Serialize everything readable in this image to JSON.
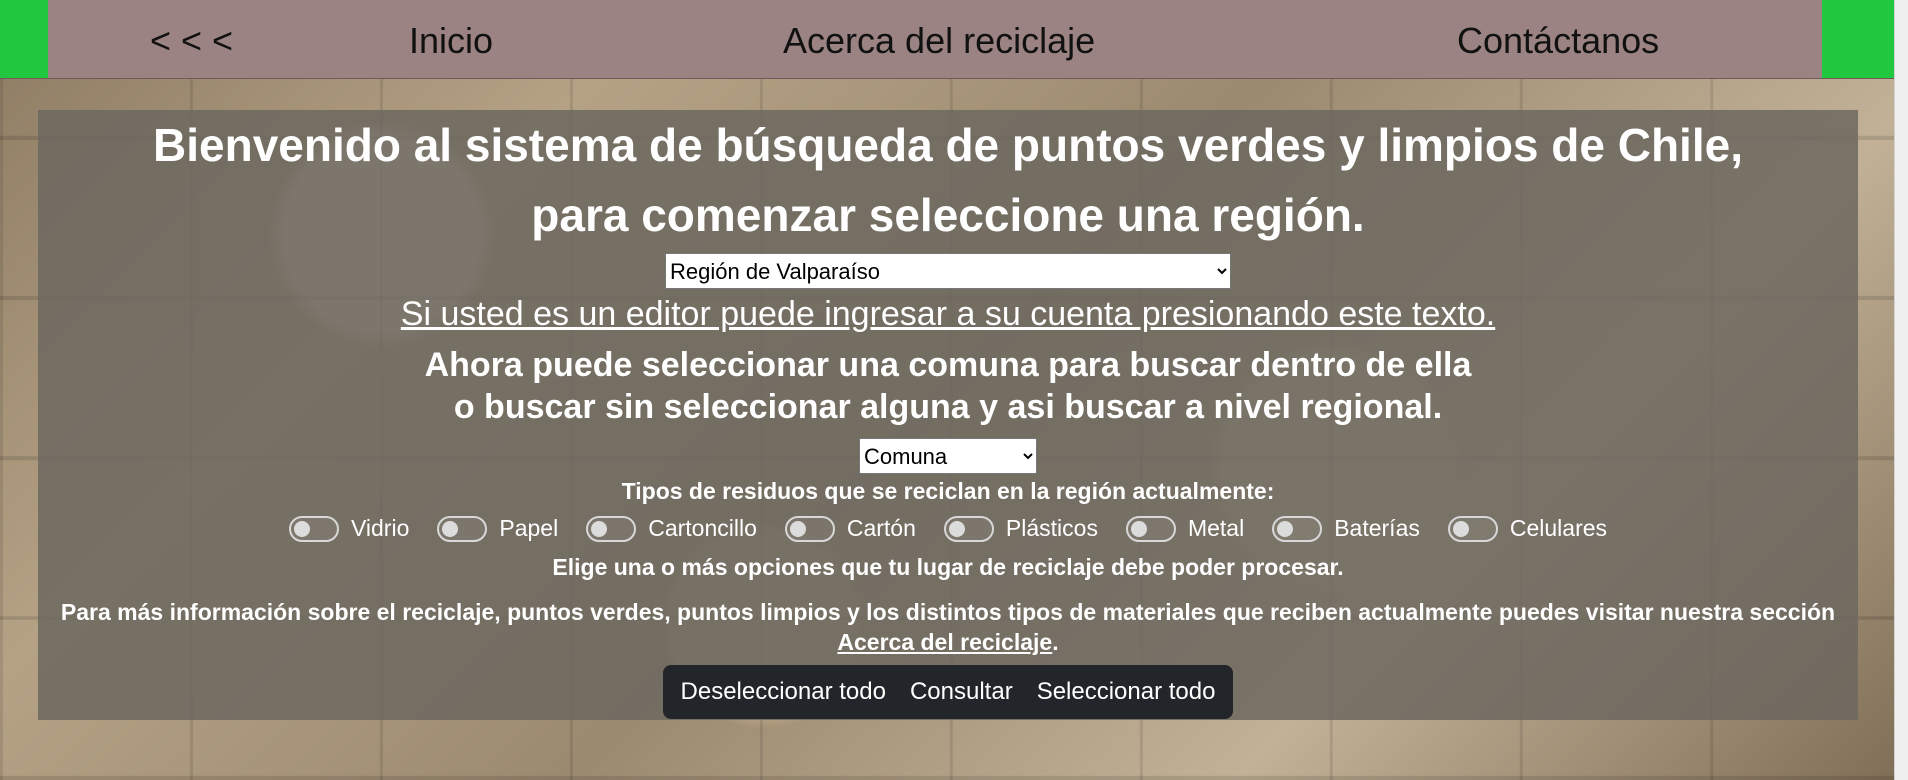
{
  "nav": {
    "back_label": "< < <",
    "home_label": "Inicio",
    "about_label": "Acerca del reciclaje",
    "contact_label": "Contáctanos"
  },
  "main": {
    "title_line1": "Bienvenido al sistema de búsqueda de puntos verdes y limpios de Chile,",
    "title_line2": "para comenzar seleccione una región.",
    "region_selected": "Región de Valparaíso",
    "editor_link": "Si usted es un editor puede ingresar a su cuenta presionando este texto.",
    "subtitle_line1": "Ahora puede seleccionar una comuna para buscar dentro de ella",
    "subtitle_line2": "o buscar sin seleccionar alguna y asi buscar a nivel regional.",
    "comuna_selected": "Comuna",
    "residuos_title": "Tipos de residuos que se reciclan en la región actualmente:",
    "toggles": [
      "Vidrio",
      "Papel",
      "Cartoncillo",
      "Cartón",
      "Plásticos",
      "Metal",
      "Baterías",
      "Celulares"
    ],
    "hint": "Elige una o más opciones que tu lugar de reciclaje debe poder procesar.",
    "info_text": "Para más información sobre el reciclaje, puntos verdes, puntos limpios y los distintos tipos de materiales que reciben actualmente puedes visitar nuestra sección",
    "info_link": "Acerca del reciclaje",
    "info_end": "."
  },
  "buttons": {
    "deselect_all": "Deseleccionar todo",
    "consult": "Consultar",
    "select_all": "Seleccionar todo"
  },
  "colors": {
    "nav_bg": "#9b8383",
    "accent_green": "#22c740",
    "panel_bg": "rgba(108,104,96,0.86)",
    "button_group_bg": "#22252a"
  }
}
